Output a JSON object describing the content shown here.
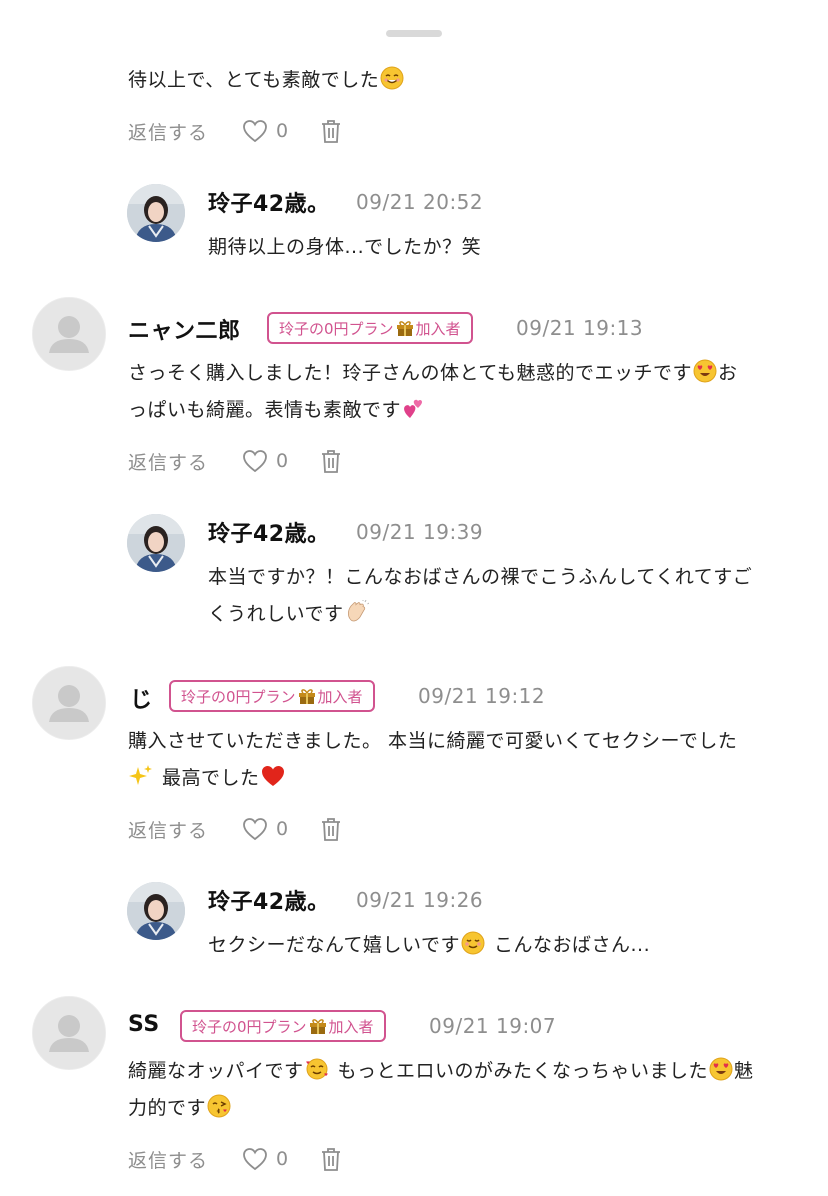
{
  "comments": {
    "top": {
      "text": "待以上で、とても素敵でした",
      "emoji": "smiling-face-emoji"
    },
    "reply1": {
      "name": "玲子42歳。",
      "time": "09/21 20:52",
      "text": "期待以上の身体...でしたか？笑"
    },
    "c1": {
      "name": "ニャン二郎",
      "badge_pre": "玲子の0円プラン",
      "badge_post": "加入者",
      "time": "09/21 19:13",
      "line1": "さっそく購入しました！玲子さんの体とても魅惑的でエッチです",
      "line1_after": "お",
      "line2": "っぱいも綺麗。表情も素敵です"
    },
    "reply2": {
      "name": "玲子42歳。",
      "time": "09/21 19:39",
      "line1": "本当ですか？！こんなおばさんの裸でこうふんしてくれてすご",
      "line2": "くうれしいです"
    },
    "c2": {
      "name": "じ",
      "badge_pre": "玲子の0円プラン",
      "badge_post": "加入者",
      "time": "09/21 19:12",
      "line1": "購入させていただきました。 本当に綺麗で可愛いくてセクシーでした",
      "line2": "最高でした"
    },
    "reply3": {
      "name": "玲子42歳。",
      "time": "09/21 19:26",
      "text1": "セクシーだなんて嬉しいです",
      "text2": "こんなおばさん..."
    },
    "c3": {
      "name": "SS",
      "badge_pre": "玲子の0円プラン",
      "badge_post": "加入者",
      "time": "09/21 19:07",
      "line1": "綺麗なオッパイです",
      "line1_mid": "もっとエロいのがみたくなっちゃいました",
      "line1_end": "魅",
      "line2": "力的です"
    }
  },
  "actions": {
    "reply_label": "返信する",
    "like_count": "0"
  },
  "colors": {
    "badge": "#d1538f",
    "muted": "#8e8e8e"
  }
}
